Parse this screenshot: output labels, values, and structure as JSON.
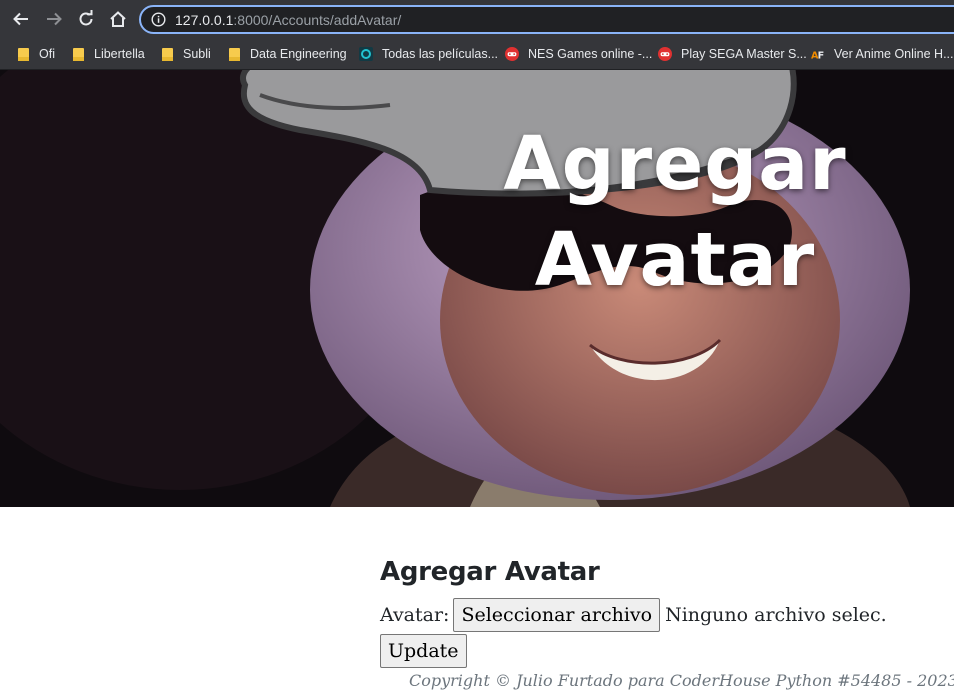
{
  "browser": {
    "url_host": "127.0.0.1",
    "url_rest": ":8000/Accounts/addAvatar/",
    "bookmarks": [
      {
        "label": "Ofi",
        "icon": "folder-icon"
      },
      {
        "label": "Libertella",
        "icon": "folder-icon"
      },
      {
        "label": "Subli",
        "icon": "folder-icon"
      },
      {
        "label": "Data Engineering",
        "icon": "folder-icon"
      },
      {
        "label": "Todas las películas...",
        "icon": "site-icon",
        "color": "#1fa7b5"
      },
      {
        "label": "NES Games online -...",
        "icon": "gamepad-icon",
        "color": "#e03131"
      },
      {
        "label": "Play SEGA Master S...",
        "icon": "gamepad-icon",
        "color": "#e03131"
      },
      {
        "label": "Ver Anime Online H...",
        "icon": "af-logo-icon",
        "color": "#f08c00"
      }
    ]
  },
  "hero": {
    "title": "Agregar Avatar"
  },
  "form": {
    "title": "Agregar Avatar",
    "avatar_label": "Avatar:",
    "file_button": "Seleccionar archivo",
    "file_status": "Ninguno archivo selec.",
    "submit": "Update"
  },
  "footer": {
    "copyright": "Copyright © Julio Furtado para CoderHouse Python #54485 - 2023"
  },
  "colors": {
    "chrome_bg": "#35363a",
    "omnibox_bg": "#202124",
    "omnibox_focus": "#8ab4f8",
    "text_dark": "#212529",
    "footer_text": "#6c757d"
  }
}
